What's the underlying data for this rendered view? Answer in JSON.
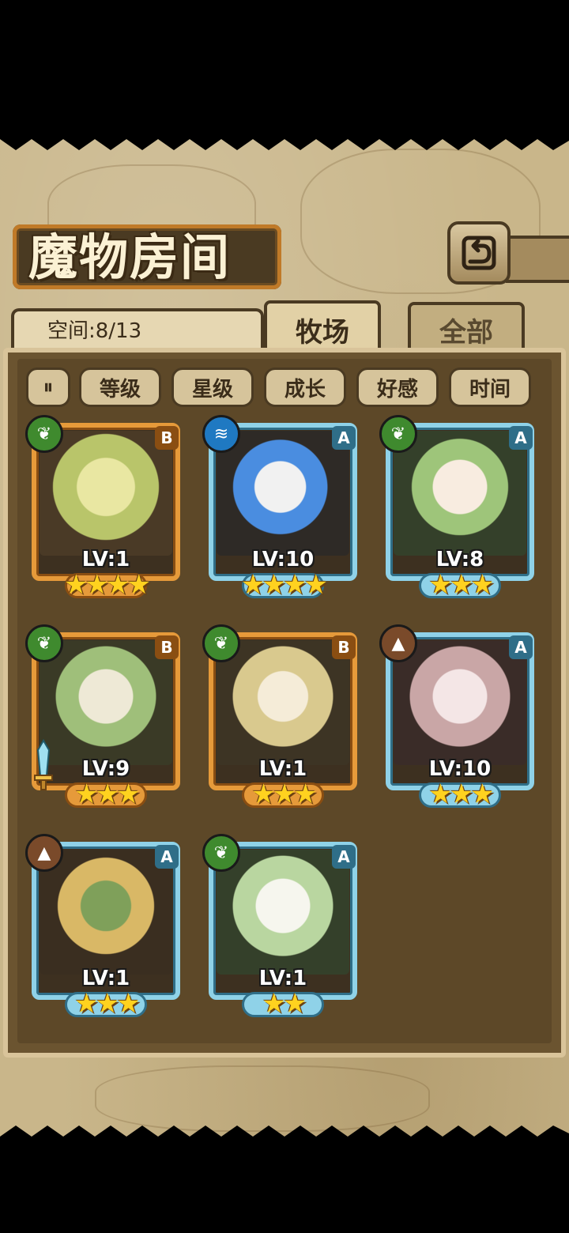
{
  "title": "魔物房间",
  "space": {
    "label": "空间:8/13"
  },
  "tabs": [
    {
      "label": "牧场",
      "active": true
    },
    {
      "label": "全部",
      "active": false
    }
  ],
  "filters": [
    "等级",
    "星级",
    "成长",
    "好感",
    "时间"
  ],
  "icons": {
    "back": "back-arrow-icon",
    "sort": "sort-toggle-icon",
    "leaf": "leaf-element-icon",
    "water": "water-element-icon",
    "earth": "earth-element-icon",
    "sword": "sword-icon"
  },
  "colors": {
    "rank_b_frame": "#e69a3a",
    "rank_a_frame": "#8fd2e8",
    "leaf": "#3f8a2e",
    "water": "#1f79c2",
    "earth": "#7a4a2a",
    "star": "#ffd21f"
  },
  "monsters": [
    {
      "rank": "B",
      "level": "LV:1",
      "stars": "★★★★",
      "element": "leaf"
    },
    {
      "rank": "A",
      "level": "LV:10",
      "stars": "★★★★",
      "element": "water"
    },
    {
      "rank": "A",
      "level": "LV:8",
      "stars": "★★★",
      "element": "leaf"
    },
    {
      "rank": "B",
      "level": "LV:9",
      "stars": "★★★",
      "element": "leaf",
      "equipped": "sword"
    },
    {
      "rank": "B",
      "level": "LV:1",
      "stars": "★★★",
      "element": "leaf"
    },
    {
      "rank": "A",
      "level": "LV:10",
      "stars": "★★★",
      "element": "earth"
    },
    {
      "rank": "A",
      "level": "LV:1",
      "stars": "★★★",
      "element": "earth"
    },
    {
      "rank": "A",
      "level": "LV:1",
      "stars": "★★",
      "element": "leaf"
    }
  ]
}
